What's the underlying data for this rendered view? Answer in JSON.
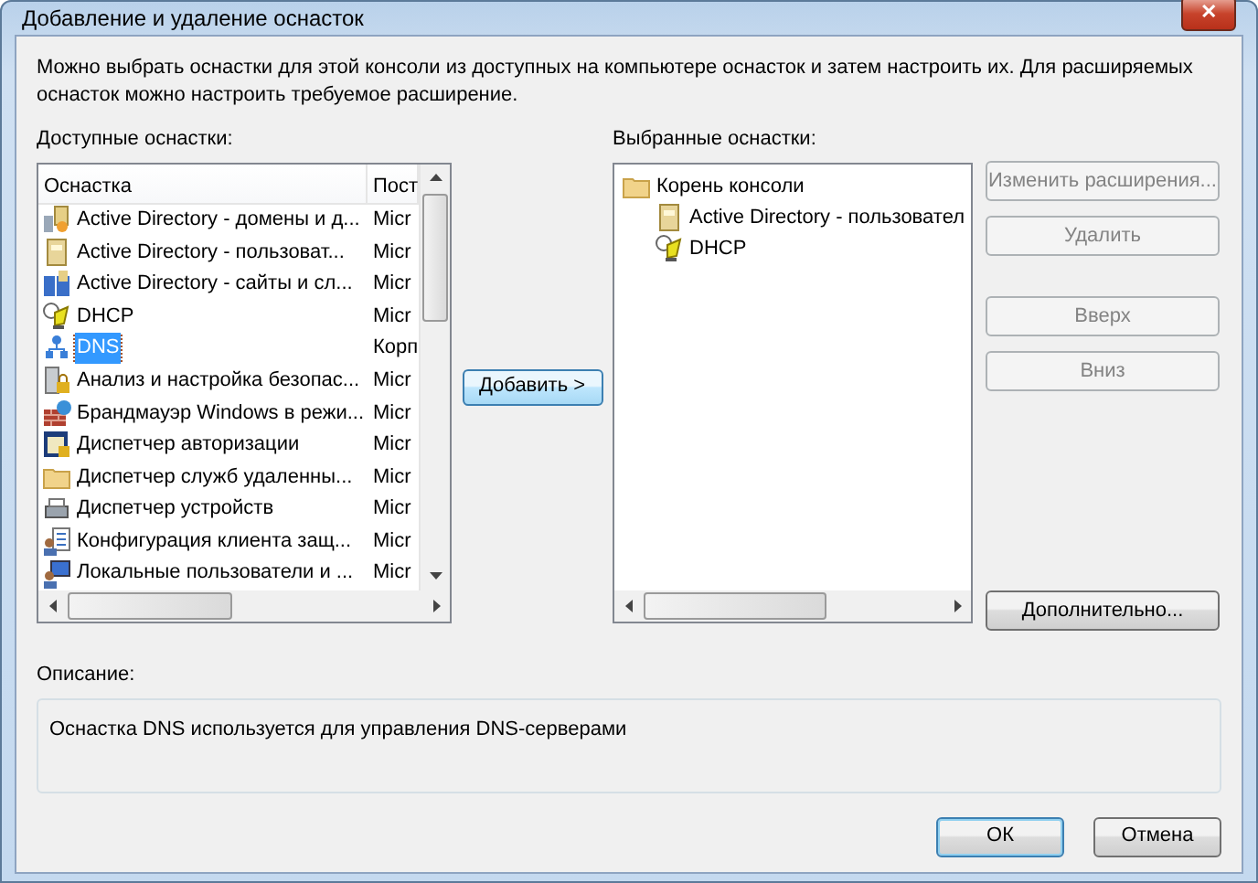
{
  "window": {
    "title": "Добавление и удаление оснасток",
    "close": "✕"
  },
  "intro": "Можно выбрать оснастки для этой консоли из доступных на компьютере оснасток и затем настроить их. Для расширяемых оснасток можно настроить требуемое расширение.",
  "available": {
    "label": "Доступные оснастки:",
    "columns": [
      "Оснастка",
      "Пост"
    ],
    "rows": [
      {
        "name": "Active Directory - домены и д...",
        "vendor": "Micr",
        "selected": false
      },
      {
        "name": "Active Directory - пользоват...",
        "vendor": "Micr",
        "selected": false
      },
      {
        "name": "Active Directory - сайты и сл...",
        "vendor": "Micr",
        "selected": false
      },
      {
        "name": "DHCP",
        "vendor": "Micr",
        "selected": false
      },
      {
        "name": "DNS",
        "vendor": "Корп",
        "selected": true
      },
      {
        "name": "Анализ и настройка безопас...",
        "vendor": "Micr",
        "selected": false
      },
      {
        "name": "Брандмауэр Windows в режи...",
        "vendor": "Micr",
        "selected": false
      },
      {
        "name": "Диспетчер авторизации",
        "vendor": "Micr",
        "selected": false
      },
      {
        "name": "Диспетчер служб удаленны...",
        "vendor": "Micr",
        "selected": false
      },
      {
        "name": "Диспетчер устройств",
        "vendor": "Micr",
        "selected": false
      },
      {
        "name": "Конфигурация клиента защ...",
        "vendor": "Micr",
        "selected": false
      },
      {
        "name": "Локальные пользователи и ...",
        "vendor": "Micr",
        "selected": false
      }
    ]
  },
  "add_button": {
    "label": "Добавить >",
    "hovered": true
  },
  "selected_snapins": {
    "label": "Выбранные оснастки:",
    "tree": [
      {
        "label": "Корень консоли",
        "children": [
          {
            "label": "Active Directory - пользовател"
          },
          {
            "label": "DHCP"
          }
        ]
      }
    ]
  },
  "side_buttons": [
    {
      "label": "Изменить расширения...",
      "disabled": true
    },
    {
      "label": "Удалить",
      "disabled": true
    },
    {
      "label": "Вверх",
      "disabled": true
    },
    {
      "label": "Вниз",
      "disabled": true
    },
    {
      "label": "Дополнительно...",
      "disabled": false
    }
  ],
  "description": {
    "label": "Описание:",
    "text": "Оснастка DNS используется для управления DNS-серверами"
  },
  "buttons": [
    {
      "label": "ОК",
      "default": true
    },
    {
      "label": "Отмена",
      "default": false
    }
  ]
}
